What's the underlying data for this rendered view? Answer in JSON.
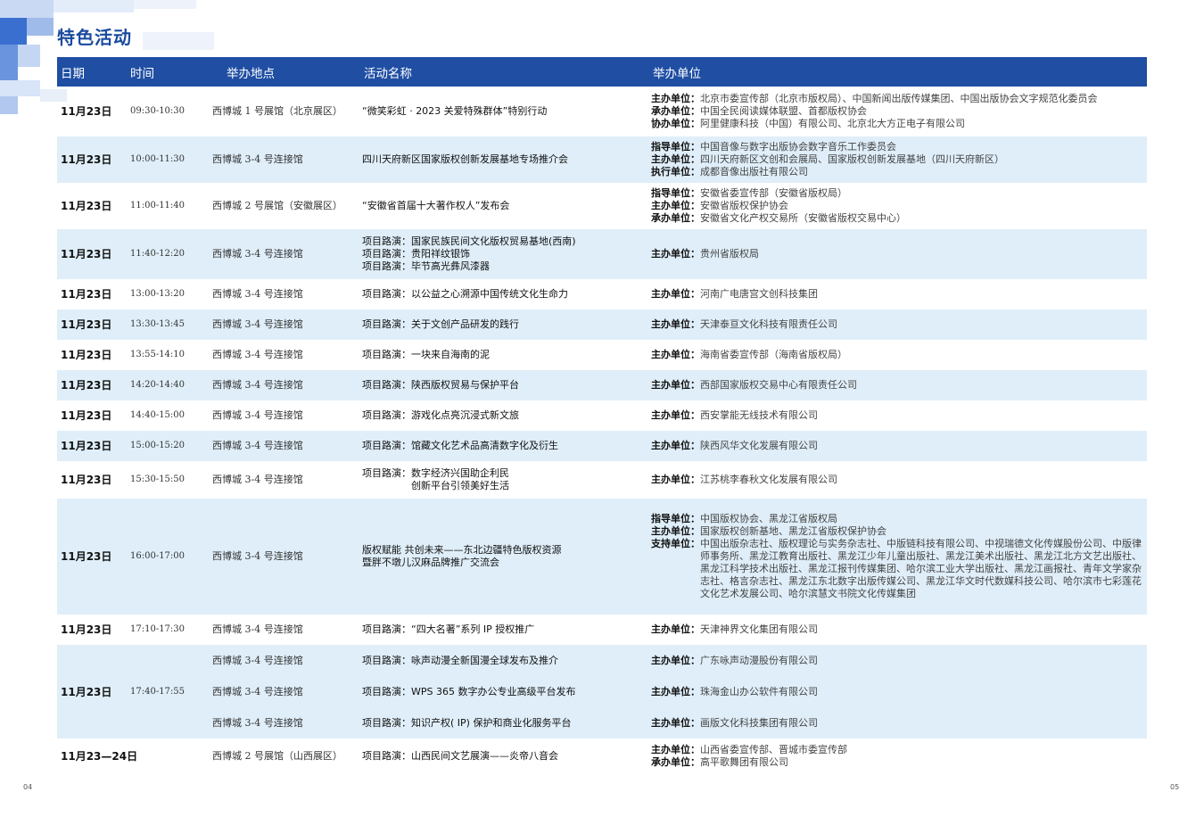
{
  "page": {
    "title": "特色活动",
    "page_left": "04",
    "page_right": "05",
    "colors": {
      "header_bg": "#1f4ea3",
      "row_shade": "#dfeef9",
      "title": "#1a4a9e"
    }
  },
  "header": {
    "date": "日期",
    "time": "时间",
    "venue": "举办地点",
    "name": "活动名称",
    "org": "举办单位"
  },
  "rows": [
    {
      "date": "11月23日",
      "time": "09:30-10:30",
      "venue": "西博城 1 号展馆（北京展区）",
      "name": [
        "“微笑彩虹 · 2023 关爱特殊群体”特别行动"
      ],
      "orgs": [
        {
          "role": "主办单位：",
          "text": "北京市委宣传部（北京市版权局）、中国新闻出版传媒集团、中国出版协会文字规范化委员会"
        },
        {
          "role": "承办单位：",
          "text": "中国全民阅读媒体联盟、首都版权协会"
        },
        {
          "role": "协办单位：",
          "text": "阿里健康科技（中国）有限公司、北京北大方正电子有限公司"
        }
      ]
    },
    {
      "date": "11月23日",
      "time": "10:00-11:30",
      "venue": "西博城 3-4 号连接馆",
      "name": [
        "四川天府新区国家版权创新发展基地专场推介会"
      ],
      "orgs": [
        {
          "role": "指导单位：",
          "text": "中国音像与数字出版协会数字音乐工作委员会"
        },
        {
          "role": "主办单位：",
          "text": "四川天府新区文创和会展局、国家版权创新发展基地（四川天府新区）"
        },
        {
          "role": "执行单位：",
          "text": "成都音像出版社有限公司"
        }
      ]
    },
    {
      "date": "11月23日",
      "time": "11:00-11:40",
      "venue": "西博城 2 号展馆（安徽展区）",
      "name": [
        "“安徽省首届十大著作权人”发布会"
      ],
      "orgs": [
        {
          "role": "指导单位：",
          "text": "安徽省委宣传部（安徽省版权局）"
        },
        {
          "role": "主办单位：",
          "text": "安徽省版权保护协会"
        },
        {
          "role": "承办单位：",
          "text": "安徽省文化产权交易所（安徽省版权交易中心）"
        }
      ]
    },
    {
      "date": "11月23日",
      "time": "11:40-12:20",
      "venue": "西博城 3-4 号连接馆",
      "name": [
        "项目路演：国家民族民间文化版权贸易基地(西南)",
        "项目路演：贵阳祥纹银饰",
        "项目路演：毕节高光彝风漆器"
      ],
      "orgs": [
        {
          "role": "主办单位：",
          "text": "贵州省版权局"
        }
      ]
    },
    {
      "date": "11月23日",
      "time": "13:00-13:20",
      "venue": "西博城 3-4 号连接馆",
      "name": [
        "项目路演：以公益之心溯源中国传统文化生命力"
      ],
      "orgs": [
        {
          "role": "主办单位：",
          "text": "河南广电唐宫文创科技集团"
        }
      ]
    },
    {
      "date": "11月23日",
      "time": "13:30-13:45",
      "venue": "西博城 3-4 号连接馆",
      "name": [
        "项目路演：关于文创产品研发的践行"
      ],
      "orgs": [
        {
          "role": "主办单位：",
          "text": "天津泰亘文化科技有限责任公司"
        }
      ]
    },
    {
      "date": "11月23日",
      "time": "13:55-14:10",
      "venue": "西博城 3-4 号连接馆",
      "name": [
        "项目路演：一块来自海南的泥"
      ],
      "orgs": [
        {
          "role": "主办单位：",
          "text": "海南省委宣传部（海南省版权局）"
        }
      ]
    },
    {
      "date": "11月23日",
      "time": "14:20-14:40",
      "venue": "西博城 3-4 号连接馆",
      "name": [
        "项目路演：陕西版权贸易与保护平台"
      ],
      "orgs": [
        {
          "role": "主办单位：",
          "text": "西部国家版权交易中心有限责任公司"
        }
      ]
    },
    {
      "date": "11月23日",
      "time": "14:40-15:00",
      "venue": "西博城 3-4 号连接馆",
      "name": [
        "项目路演：游戏化点亮沉浸式新文旅"
      ],
      "orgs": [
        {
          "role": "主办单位：",
          "text": "西安掌能无线技术有限公司"
        }
      ]
    },
    {
      "date": "11月23日",
      "time": "15:00-15:20",
      "venue": "西博城 3-4 号连接馆",
      "name": [
        "项目路演：馆藏文化艺术品高清数字化及衍生"
      ],
      "orgs": [
        {
          "role": "主办单位：",
          "text": "陕西风华文化发展有限公司"
        }
      ]
    },
    {
      "date": "11月23日",
      "time": "15:30-15:50",
      "venue": "西博城 3-4 号连接馆",
      "name": [
        "项目路演：数字经济兴国助企利民",
        "　　　　　创新平台引领美好生活"
      ],
      "orgs": [
        {
          "role": "主办单位：",
          "text": "江苏桃李春秋文化发展有限公司"
        }
      ]
    },
    {
      "date": "11月23日",
      "time": "16:00-17:00",
      "venue": "西博城 3-4 号连接馆",
      "name": [
        "版权赋能 共创未来——东北边疆特色版权资源",
        "暨胖不墩儿汉麻品牌推广交流会"
      ],
      "orgs": [
        {
          "role": "指导单位：",
          "text": "中国版权协会、黑龙江省版权局"
        },
        {
          "role": "主办单位：",
          "text": "国家版权创新基地、黑龙江省版权保护协会"
        },
        {
          "role": "支持单位：",
          "text": "中国出版杂志社、版权理论与实务杂志社、中版链科技有限公司、中视瑞德文化传媒股份公司、中版律师事务所、黑龙江教育出版社、黑龙江少年儿童出版社、黑龙江美术出版社、黑龙江北方文艺出版社、黑龙江科学技术出版社、黑龙江报刊传媒集团、哈尔滨工业大学出版社、黑龙江画报社、青年文学家杂志社、格言杂志社、黑龙江东北数字出版传媒公司、黑龙江华文时代数媒科技公司、哈尔滨市七彩莲花文化艺术发展公司、哈尔滨慧文书院文化传媒集团"
        }
      ]
    },
    {
      "date": "11月23日",
      "time": "17:10-17:30",
      "venue": "西博城 3-4 号连接馆",
      "name": [
        "项目路演：“四大名著”系列 IP 授权推广"
      ],
      "orgs": [
        {
          "role": "主办单位：",
          "text": "天津神界文化集团有限公司"
        }
      ]
    }
  ],
  "group": {
    "date": "11月23日",
    "time": "17:40-17:55",
    "items": [
      {
        "venue": "西博城 3-4 号连接馆",
        "name": "项目路演：咏声动漫全新国漫全球发布及推介",
        "role": "主办单位：",
        "org": "广东咏声动漫股份有限公司"
      },
      {
        "venue": "西博城 3-4 号连接馆",
        "name": "项目路演：WPS 365 数字办公专业高级平台发布",
        "role": "主办单位：",
        "org": "珠海金山办公软件有限公司"
      },
      {
        "venue": "西博城 3-4 号连接馆",
        "name": "项目路演：知识产权( IP) 保护和商业化服务平台",
        "role": "主办单位：",
        "org": "画版文化科技集团有限公司"
      }
    ]
  },
  "last": {
    "date": "11月23—24日",
    "venue": "西博城 2 号展馆（山西展区）",
    "name": "项目路演：山西民间文艺展演——炎帝八音会",
    "orgs": [
      {
        "role": "主办单位：",
        "text": "山西省委宣传部、晋城市委宣传部"
      },
      {
        "role": "承办单位：",
        "text": "高平歌舞团有限公司"
      }
    ]
  }
}
